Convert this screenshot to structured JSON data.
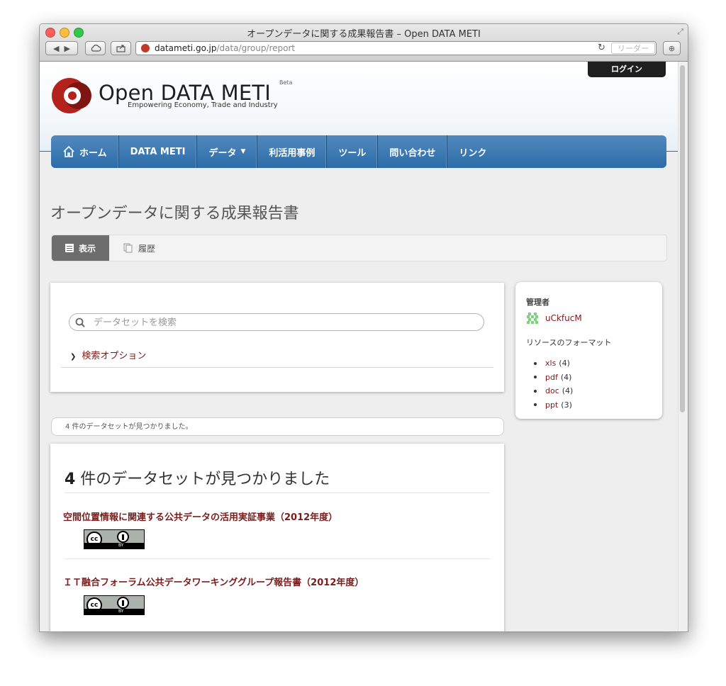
{
  "window": {
    "title": "オープンデータに関する成果報告書 – Open DATA METI",
    "url_host": "datameti.go.jp",
    "url_path": "/data/group/report",
    "reader_label": "リーダー"
  },
  "header": {
    "login_label": "ログイン",
    "logo_name": "Open DATA METI",
    "logo_beta": "Beta",
    "logo_tagline": "Empowering Economy, Trade and Industry",
    "brand_color": "#b3221c"
  },
  "nav": {
    "items": [
      {
        "label": "ホーム"
      },
      {
        "label": "DATA METI"
      },
      {
        "label": "データ"
      },
      {
        "label": "利活用事例"
      },
      {
        "label": "ツール"
      },
      {
        "label": "問い合わせ"
      },
      {
        "label": "リンク"
      }
    ],
    "color": "#2f6ea8"
  },
  "page": {
    "title": "オープンデータに関する成果報告書",
    "tabs": [
      {
        "label": "表示"
      },
      {
        "label": "履歴"
      }
    ]
  },
  "search": {
    "placeholder": "データセットを検索",
    "options_label": "検索オプション"
  },
  "sidebar": {
    "admin_heading": "管理者",
    "admin_name": "uCkfucM",
    "formats_heading": "リソースのフォーマット",
    "formats": [
      {
        "name": "xls",
        "count": "(4)"
      },
      {
        "name": "pdf",
        "count": "(4)"
      },
      {
        "name": "doc",
        "count": "(4)"
      },
      {
        "name": "ppt",
        "count": "(3)"
      }
    ]
  },
  "results": {
    "found_text": "4 件のデータセットが見つかりました。",
    "heading_count": "4",
    "heading_text": " 件のデータセットが見つかりました",
    "datasets": [
      {
        "title": "空間位置情報に関連する公共データの活用実証事業（2012年度）",
        "license_cc": "cc",
        "license_by": "BY"
      },
      {
        "title": "ＩＴ融合フォーラム公共データワーキンググループ報告書（2012年度）",
        "license_cc": "cc",
        "license_by": "BY"
      }
    ]
  }
}
